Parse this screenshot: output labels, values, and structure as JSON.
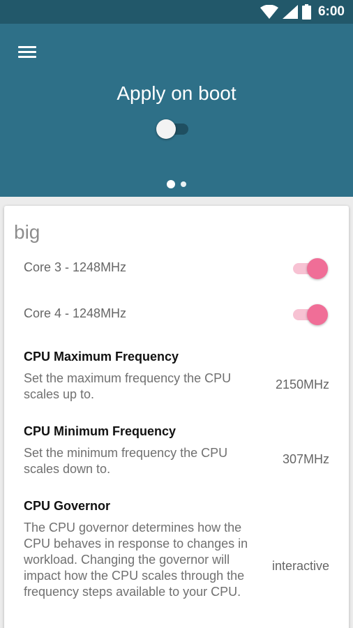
{
  "status_bar": {
    "time": "6:00",
    "icons": [
      "wifi-icon",
      "signal-icon",
      "battery-icon"
    ]
  },
  "header": {
    "menu_icon": "hamburger-menu-icon",
    "title": "Apply on boot",
    "apply_on_boot_enabled": false,
    "page_indicator": {
      "pages": 2,
      "current": 1
    }
  },
  "section": {
    "title": "big",
    "cores": [
      {
        "label": "Core 3 - 1248MHz",
        "enabled": true
      },
      {
        "label": "Core 4 - 1248MHz",
        "enabled": true
      }
    ],
    "preferences": [
      {
        "title": "CPU Maximum Frequency",
        "description": "Set the maximum frequency the CPU scales up to.",
        "value": "2150MHz"
      },
      {
        "title": "CPU Minimum Frequency",
        "description": "Set the minimum frequency the CPU scales down to.",
        "value": "307MHz"
      },
      {
        "title": "CPU Governor",
        "description": "The CPU governor determines how the CPU behaves in response to changes in workload. Changing the governor will impact how the CPU scales through the frequency steps available to your CPU.",
        "value": "interactive"
      }
    ]
  },
  "colors": {
    "status_bar": "#22586a",
    "toolbar": "#2e7088",
    "accent": "#f06e97",
    "accent_track": "#f7c2d3",
    "card": "#ffffff",
    "background": "#ececec"
  }
}
